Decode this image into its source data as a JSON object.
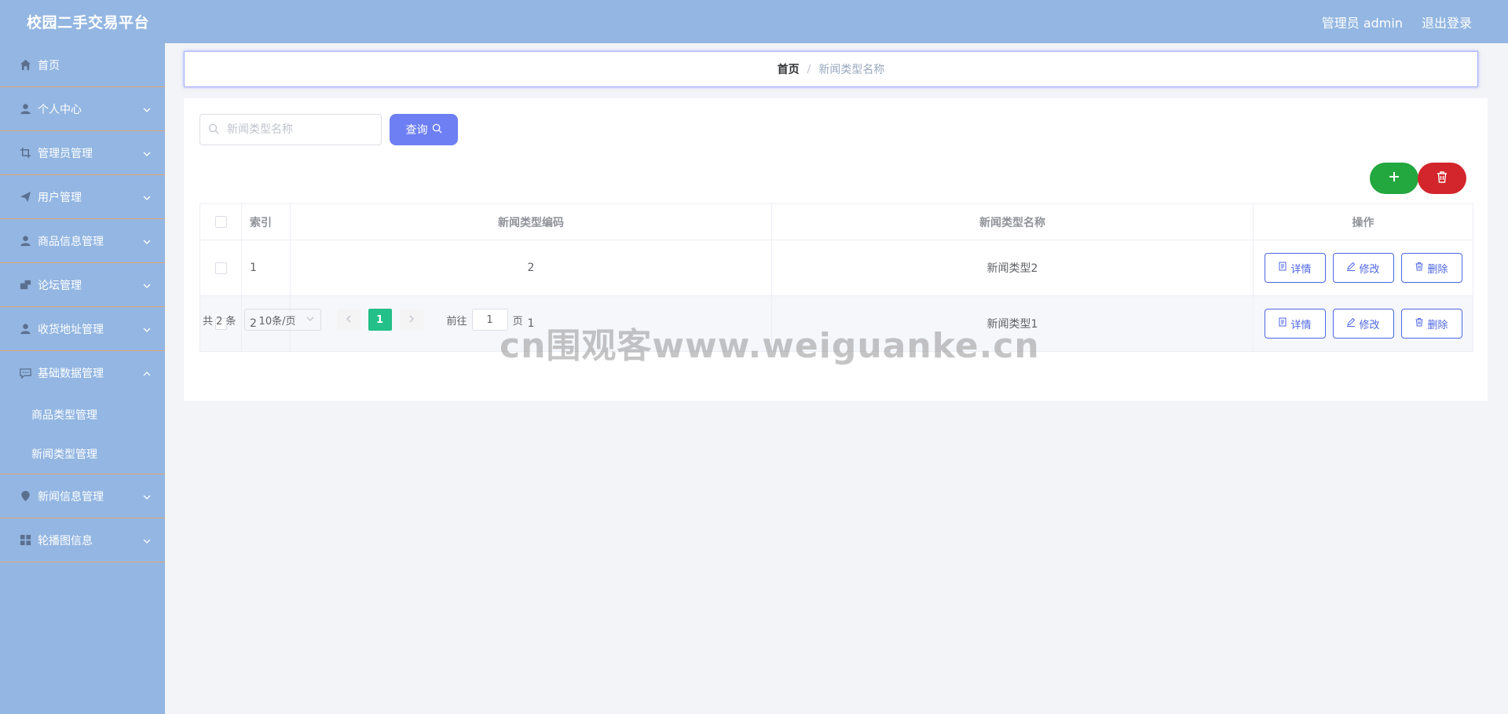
{
  "header": {
    "title": "校园二手交易平台",
    "user_label": "管理员 admin",
    "logout_label": "退出登录"
  },
  "sidebar": {
    "items": [
      {
        "label": "首页",
        "icon": "home-icon"
      },
      {
        "label": "个人中心",
        "icon": "user-icon"
      },
      {
        "label": "管理员管理",
        "icon": "crop-icon"
      },
      {
        "label": "用户管理",
        "icon": "send-icon"
      },
      {
        "label": "商品信息管理",
        "icon": "user-icon"
      },
      {
        "label": "论坛管理",
        "icon": "chat-icon"
      },
      {
        "label": "收货地址管理",
        "icon": "user-icon"
      },
      {
        "label": "基础数据管理",
        "icon": "comment-icon"
      },
      {
        "label": "新闻信息管理",
        "icon": "location-icon"
      },
      {
        "label": "轮播图信息",
        "icon": "grid-icon"
      }
    ],
    "subitems": [
      {
        "label": "商品类型管理"
      },
      {
        "label": "新闻类型管理"
      }
    ]
  },
  "breadcrumb": {
    "home": "首页",
    "separator": "/",
    "current": "新闻类型名称"
  },
  "search": {
    "placeholder": "新闻类型名称",
    "value": "",
    "button_label": "查询"
  },
  "table": {
    "headers": [
      "索引",
      "新闻类型编码",
      "新闻类型名称",
      "操作"
    ],
    "rows": [
      {
        "index": "1",
        "code": "2",
        "name": "新闻类型2"
      },
      {
        "index": "2",
        "code": "1",
        "name": "新闻类型1"
      }
    ],
    "actions": {
      "detail": "详情",
      "edit": "修改",
      "delete": "删除"
    }
  },
  "pagination": {
    "total": "共 2 条",
    "page_size": "10条/页",
    "current_page": "1",
    "goto_label": "前往",
    "goto_value": "1",
    "page_suffix": "页"
  },
  "watermark": "cn围观客www.weiguanke.cn",
  "colors": {
    "topbar": "#93b6e2",
    "sidebar": "#93b6e2",
    "query_button": "#6e7ff3",
    "add_button": "#23a73f",
    "delete_button": "#d3262c",
    "action_outline": "#4d66e4",
    "active_page": "#23c08a"
  }
}
